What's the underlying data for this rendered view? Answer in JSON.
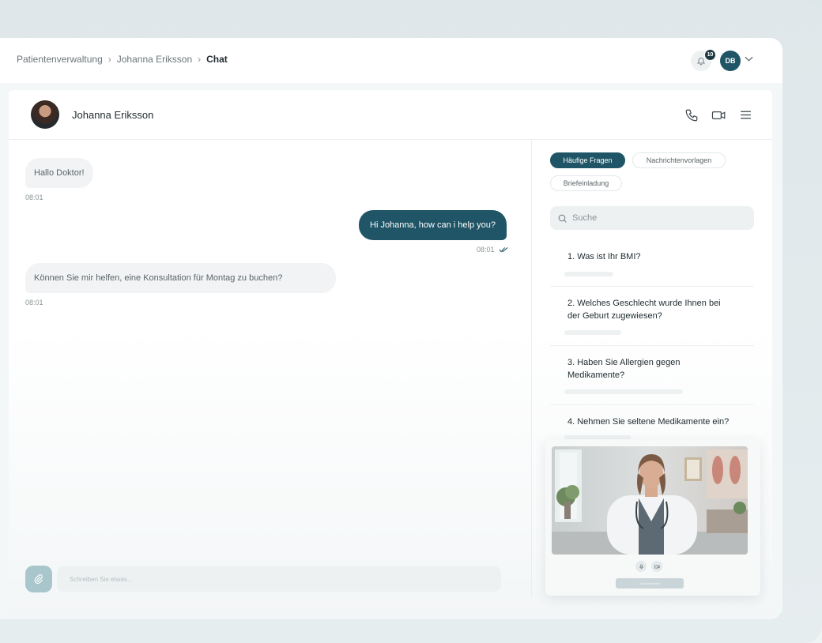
{
  "breadcrumb": {
    "items": [
      "Patientenverwaltung",
      "Johanna Eriksson"
    ],
    "current": "Chat"
  },
  "header": {
    "notification_count": "10",
    "user_initials": "DB"
  },
  "chat": {
    "contact_name": "Johanna Eriksson",
    "messages": [
      {
        "direction": "in",
        "text": "Hallo Doktor!",
        "time": "08:01"
      },
      {
        "direction": "out",
        "text": "Hi Johanna, how can i help you?",
        "time": "08:01",
        "status": "read"
      },
      {
        "direction": "in",
        "text": "Können Sie mir helfen, eine Konsultation für Montag zu buchen?",
        "time": "08:01"
      }
    ],
    "composer_placeholder": "Schreiben Sie etwas..."
  },
  "side_panel": {
    "tabs": [
      {
        "label": "Häufige Fragen",
        "active": true
      },
      {
        "label": "Nachrichtenvorlagen",
        "active": false
      },
      {
        "label": "Briefeinladung",
        "active": false
      }
    ],
    "search_placeholder": "Suche",
    "questions": [
      "1. Was ist Ihr BMI?",
      "2. Welches Geschlecht wurde Ihnen bei der Geburt zugewiesen?",
      "3. Haben Sie Allergien gegen Medikamente?",
      "4. Nehmen Sie seltene Medikamente ein?"
    ]
  },
  "video_call": {
    "end_label": "Anruf beenden"
  },
  "colors": {
    "accent": "#1f5566",
    "bubble_in": "#f1f3f4",
    "background": "#dfe7ea"
  },
  "icons": [
    "bell-icon",
    "chevron-down-icon",
    "phone-icon",
    "video-icon",
    "menu-icon",
    "search-icon",
    "paperclip-icon",
    "double-check-icon",
    "mic-icon",
    "camera-icon"
  ]
}
